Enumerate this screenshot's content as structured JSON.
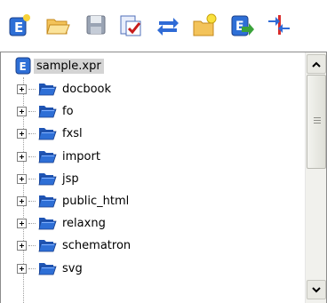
{
  "toolbar": {
    "buttons": [
      {
        "name": "new-project-icon"
      },
      {
        "name": "open-folder-icon"
      },
      {
        "name": "save-icon"
      },
      {
        "name": "validate-icon"
      },
      {
        "name": "swap-icon"
      },
      {
        "name": "new-folder-icon"
      },
      {
        "name": "add-file-icon"
      },
      {
        "name": "split-icon"
      }
    ]
  },
  "tree": {
    "root": {
      "label": "sample.xpr",
      "icon": "project-file-icon"
    },
    "items": [
      {
        "label": "docbook"
      },
      {
        "label": "fo"
      },
      {
        "label": "fxsl"
      },
      {
        "label": "import"
      },
      {
        "label": "jsp"
      },
      {
        "label": "public_html"
      },
      {
        "label": "relaxng"
      },
      {
        "label": "schematron"
      },
      {
        "label": "svg"
      }
    ]
  },
  "colors": {
    "folder": "#2e6fd6",
    "selection": "#d4d4d4",
    "scrollbar_track": "#f1f1ed"
  }
}
